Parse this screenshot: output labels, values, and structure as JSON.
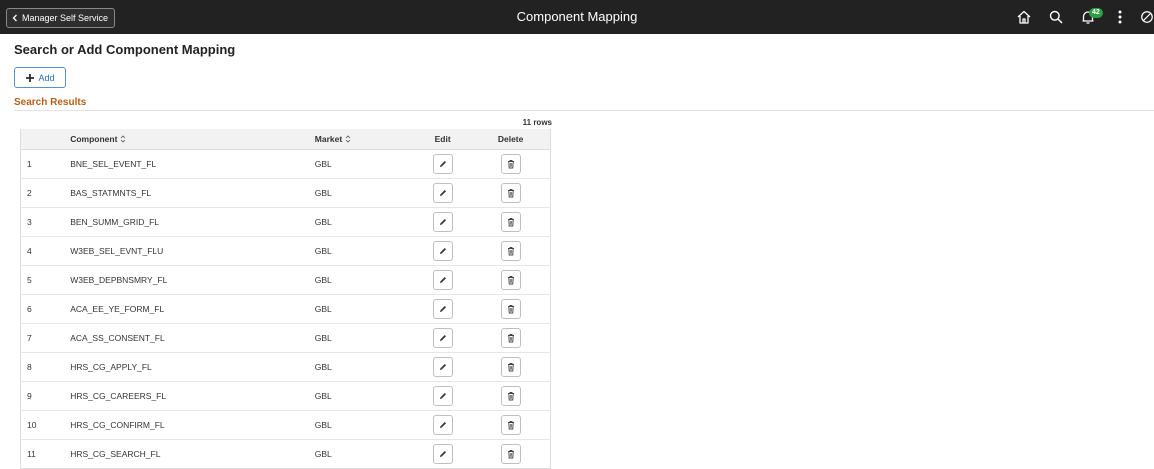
{
  "header": {
    "back_label": "Manager Self Service",
    "title": "Component Mapping",
    "notification_count": "42"
  },
  "page": {
    "title": "Search or Add Component Mapping",
    "add_label": "Add",
    "section_title": "Search Results",
    "row_count": "11 rows"
  },
  "grid": {
    "columns": {
      "component": "Component",
      "market": "Market",
      "edit": "Edit",
      "delete": "Delete"
    },
    "rows": [
      {
        "num": "1",
        "component": "BNE_SEL_EVENT_FL",
        "market": "GBL"
      },
      {
        "num": "2",
        "component": "BAS_STATMNTS_FL",
        "market": "GBL"
      },
      {
        "num": "3",
        "component": "BEN_SUMM_GRID_FL",
        "market": "GBL"
      },
      {
        "num": "4",
        "component": "W3EB_SEL_EVNT_FLU",
        "market": "GBL"
      },
      {
        "num": "5",
        "component": "W3EB_DEPBNSMRY_FL",
        "market": "GBL"
      },
      {
        "num": "6",
        "component": "ACA_EE_YE_FORM_FL",
        "market": "GBL"
      },
      {
        "num": "7",
        "component": "ACA_SS_CONSENT_FL",
        "market": "GBL"
      },
      {
        "num": "8",
        "component": "HRS_CG_APPLY_FL",
        "market": "GBL"
      },
      {
        "num": "9",
        "component": "HRS_CG_CAREERS_FL",
        "market": "GBL"
      },
      {
        "num": "10",
        "component": "HRS_CG_CONFIRM_FL",
        "market": "GBL"
      },
      {
        "num": "11",
        "component": "HRS_CG_SEARCH_FL",
        "market": "GBL"
      }
    ]
  },
  "icons": {
    "back": "chevron-left-icon",
    "home": "home-icon",
    "search": "search-icon",
    "notifications": "bell-icon",
    "menu": "more-vertical-icon",
    "navbar": "compass-icon",
    "add": "plus-icon",
    "sort": "sort-icon",
    "edit": "pencil-icon",
    "delete": "trash-icon"
  },
  "colors": {
    "header_bg": "#222222",
    "section_title": "#b85f17",
    "add_border": "#5a8fc9",
    "badge_bg": "#2f9e44"
  }
}
